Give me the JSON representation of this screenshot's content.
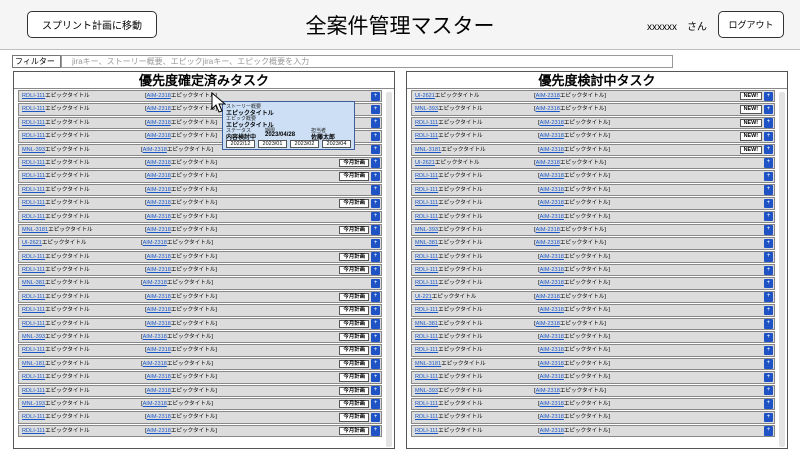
{
  "header": {
    "sprint_button": "スプリント計画に移動",
    "title": "全案件管理マスター",
    "user_name": "xxxxxx　さん",
    "logout_button": "ログアウト"
  },
  "filter": {
    "label": "フィルター",
    "placeholder": "jiraキー、ストーリー概要、エピックjiraキー、エピック概要を入力"
  },
  "left_panel": {
    "title": "優先度確定済みタスク",
    "rows": [
      {
        "key": "RDLI-111",
        "text": "エピックタイトル",
        "epic_key": "AIM-2318",
        "epic_text": "エピックタイトル",
        "badge": ""
      },
      {
        "key": "RDLI-111",
        "text": "エピックタイトル",
        "epic_key": "AIM-2318",
        "epic_text": "エピックタイトル",
        "badge": ""
      },
      {
        "key": "RDLI-111",
        "text": "エピックタイトル",
        "epic_key": "AIM-2318",
        "epic_text": "エピックタイトル",
        "badge": ""
      },
      {
        "key": "RDLI-111",
        "text": "エピックタイトル",
        "epic_key": "AIM-2318",
        "epic_text": "エピックタイトル",
        "badge": ""
      },
      {
        "key": "MNL-393",
        "text": "エピックタイトル",
        "epic_key": "AIM-2318",
        "epic_text": "エピックタイトル",
        "badge": ""
      },
      {
        "key": "RDLI-111",
        "text": "エピックタイトル",
        "epic_key": "AIM-2318",
        "epic_text": "エピックタイトル",
        "badge": "今月計画"
      },
      {
        "key": "RDLI-111",
        "text": "エピックタイトル",
        "epic_key": "AIM-2318",
        "epic_text": "エピックタイトル",
        "badge": "今月計画"
      },
      {
        "key": "RDLI-111",
        "text": "エピックタイトル",
        "epic_key": "AIM-2318",
        "epic_text": "エピックタイトル",
        "badge": ""
      },
      {
        "key": "RDLI-111",
        "text": "エピックタイトル",
        "epic_key": "AIM-2318",
        "epic_text": "エピックタイトル",
        "badge": "今月計画"
      },
      {
        "key": "RDLI-111",
        "text": "エピックタイトル",
        "epic_key": "AIM-2318",
        "epic_text": "エピックタイトル",
        "badge": ""
      },
      {
        "key": "MNL-3181",
        "text": "エピックタイトル",
        "epic_key": "AIM-2318",
        "epic_text": "エピックタイトル",
        "badge": "今月計画"
      },
      {
        "key": "UI-2621",
        "text": "エピックタイトル",
        "epic_key": "AIM-2318",
        "epic_text": "エピックタイトル",
        "badge": ""
      },
      {
        "key": "RDLI-111",
        "text": "エピックタイトル",
        "epic_key": "AIM-2318",
        "epic_text": "エピックタイトル",
        "badge": "今月計画"
      },
      {
        "key": "RDLI-111",
        "text": "エピックタイトル",
        "epic_key": "AIM-2318",
        "epic_text": "エピックタイトル",
        "badge": "今月計画"
      },
      {
        "key": "MNL-381",
        "text": "エピックタイトル",
        "epic_key": "AIM-2318",
        "epic_text": "エピックタイトル",
        "badge": ""
      },
      {
        "key": "RDLI-111",
        "text": "エピックタイトル",
        "epic_key": "AIM-2318",
        "epic_text": "エピックタイトル",
        "badge": "今月計画"
      },
      {
        "key": "RDLI-111",
        "text": "エピックタイトル",
        "epic_key": "AIM-2318",
        "epic_text": "エピックタイトル",
        "badge": "今月計画"
      },
      {
        "key": "RDLI-111",
        "text": "エピックタイトル",
        "epic_key": "AIM-2318",
        "epic_text": "エピックタイトル",
        "badge": "今月計画"
      },
      {
        "key": "MNL-393",
        "text": "エピックタイトル",
        "epic_key": "AIM-2318",
        "epic_text": "エピックタイトル",
        "badge": "今月計画"
      },
      {
        "key": "RDLI-111",
        "text": "エピックタイトル",
        "epic_key": "AIM-2318",
        "epic_text": "エピックタイトル",
        "badge": "今月計画"
      },
      {
        "key": "MNL-181",
        "text": "エピックタイトル",
        "epic_key": "AIM-2318",
        "epic_text": "エピックタイトル",
        "badge": "今月計画"
      },
      {
        "key": "RDLI-111",
        "text": "エピックタイトル",
        "epic_key": "AIM-2318",
        "epic_text": "エピックタイトル",
        "badge": "今月計画"
      },
      {
        "key": "RDLI-111",
        "text": "エピックタイトル",
        "epic_key": "AIM-2318",
        "epic_text": "エピックタイトル",
        "badge": "今月計画"
      },
      {
        "key": "MNL-193",
        "text": "エピックタイトル",
        "epic_key": "AIM-2318",
        "epic_text": "エピックタイトル",
        "badge": "今月計画"
      },
      {
        "key": "RDLI-111",
        "text": "エピックタイトル",
        "epic_key": "AIM-2318",
        "epic_text": "エピックタイトル",
        "badge": "今月計画"
      },
      {
        "key": "RDLI-111",
        "text": "エピックタイトル",
        "epic_key": "AIM-2318",
        "epic_text": "エピックタイトル",
        "badge": "今月計画"
      }
    ]
  },
  "right_panel": {
    "title": "優先度検討中タスク",
    "rows": [
      {
        "key": "UI-2621",
        "text": "エピックタイトル",
        "epic_key": "AIM-2318",
        "epic_text": "エピックタイトル",
        "badge": "NEW!"
      },
      {
        "key": "MNL-393",
        "text": "エピックタイトル",
        "epic_key": "AIM-2318",
        "epic_text": "エピックタイトル",
        "badge": "NEW!"
      },
      {
        "key": "RDLI-111",
        "text": "エピックタイトル",
        "epic_key": "AIM-2318",
        "epic_text": "エピックタイトル",
        "badge": "NEW!"
      },
      {
        "key": "RDLI-111",
        "text": "エピックタイトル",
        "epic_key": "AIM-2318",
        "epic_text": "エピックタイトル",
        "badge": "NEW!"
      },
      {
        "key": "MNL-3181",
        "text": "エピックタイトル",
        "epic_key": "AIM-2318",
        "epic_text": "エピックタイトル",
        "badge": "NEW!"
      },
      {
        "key": "UI-2621",
        "text": "エピックタイトル",
        "epic_key": "AIM-2318",
        "epic_text": "エピックタイトル",
        "badge": ""
      },
      {
        "key": "RDLI-111",
        "text": "エピックタイトル",
        "epic_key": "AIM-2318",
        "epic_text": "エピックタイトル",
        "badge": ""
      },
      {
        "key": "RDLI-111",
        "text": "エピックタイトル",
        "epic_key": "AIM-2318",
        "epic_text": "エピックタイトル",
        "badge": ""
      },
      {
        "key": "RDLI-111",
        "text": "エピックタイトル",
        "epic_key": "AIM-2318",
        "epic_text": "エピックタイトル",
        "badge": ""
      },
      {
        "key": "RDLI-111",
        "text": "エピックタイトル",
        "epic_key": "AIM-2318",
        "epic_text": "エピックタイトル",
        "badge": ""
      },
      {
        "key": "MNL-393",
        "text": "エピックタイトル",
        "epic_key": "AIM-2318",
        "epic_text": "エピックタイトル",
        "badge": ""
      },
      {
        "key": "MNL-381",
        "text": "エピックタイトル",
        "epic_key": "AIM-2318",
        "epic_text": "エピックタイトル",
        "badge": ""
      },
      {
        "key": "RDLI-111",
        "text": "エピックタイトル",
        "epic_key": "AIM-2318",
        "epic_text": "エピックタイトル",
        "badge": ""
      },
      {
        "key": "RDLI-111",
        "text": "エピックタイトル",
        "epic_key": "AIM-2318",
        "epic_text": "エピックタイトル",
        "badge": ""
      },
      {
        "key": "RDLI-111",
        "text": "エピックタイトル",
        "epic_key": "AIM-2318",
        "epic_text": "エピックタイトル",
        "badge": ""
      },
      {
        "key": "UI-221",
        "text": "エピックタイトル",
        "epic_key": "AIM-2318",
        "epic_text": "エピックタイトル",
        "badge": ""
      },
      {
        "key": "RDLI-111",
        "text": "エピックタイトル",
        "epic_key": "AIM-2318",
        "epic_text": "エピックタイトル",
        "badge": ""
      },
      {
        "key": "MNL-381",
        "text": "エピックタイトル",
        "epic_key": "AIM-2318",
        "epic_text": "エピックタイトル",
        "badge": ""
      },
      {
        "key": "RDLI-111",
        "text": "エピックタイトル",
        "epic_key": "AIM-2318",
        "epic_text": "エピックタイトル",
        "badge": ""
      },
      {
        "key": "RDLI-111",
        "text": "エピックタイトル",
        "epic_key": "AIM-2318",
        "epic_text": "エピックタイトル",
        "badge": ""
      },
      {
        "key": "MNL-3181",
        "text": "エピックタイトル",
        "epic_key": "AIM-2318",
        "epic_text": "エピックタイトル",
        "badge": ""
      },
      {
        "key": "RDLI-111",
        "text": "エピックタイトル",
        "epic_key": "AIM-2318",
        "epic_text": "エピックタイトル",
        "badge": ""
      },
      {
        "key": "MNL-393",
        "text": "エピックタイトル",
        "epic_key": "AIM-2318",
        "epic_text": "エピックタイトル",
        "badge": ""
      },
      {
        "key": "RDLI-111",
        "text": "エピックタイトル",
        "epic_key": "AIM-2318",
        "epic_text": "エピックタイトル",
        "badge": ""
      },
      {
        "key": "RDLI-111",
        "text": "エピックタイトル",
        "epic_key": "AIM-2318",
        "epic_text": "エピックタイトル",
        "badge": ""
      },
      {
        "key": "RDLI-111",
        "text": "エピックタイトル",
        "epic_key": "AIM-2318",
        "epic_text": "エピックタイトル",
        "badge": ""
      }
    ]
  },
  "popup": {
    "story_label": "ストーリー概要",
    "story_value": "エピックタイトル",
    "epic_label": "エピック概要",
    "epic_value": "エピックタイトル",
    "status_label": "ステータス",
    "deadline_label": "期限",
    "owner_label": "担当者",
    "status_value": "内容検討中",
    "deadline_value": "2023/04/28",
    "owner_value": "佐藤太郎",
    "sprints": [
      "2022/12",
      "2023/01",
      "2023/02",
      "2023/04"
    ]
  },
  "colors": {
    "link": "#1a57c7",
    "row_bg": "#dcdcdc",
    "plus_button": "#1f52c4",
    "popup_bg": "#ccdff5"
  }
}
